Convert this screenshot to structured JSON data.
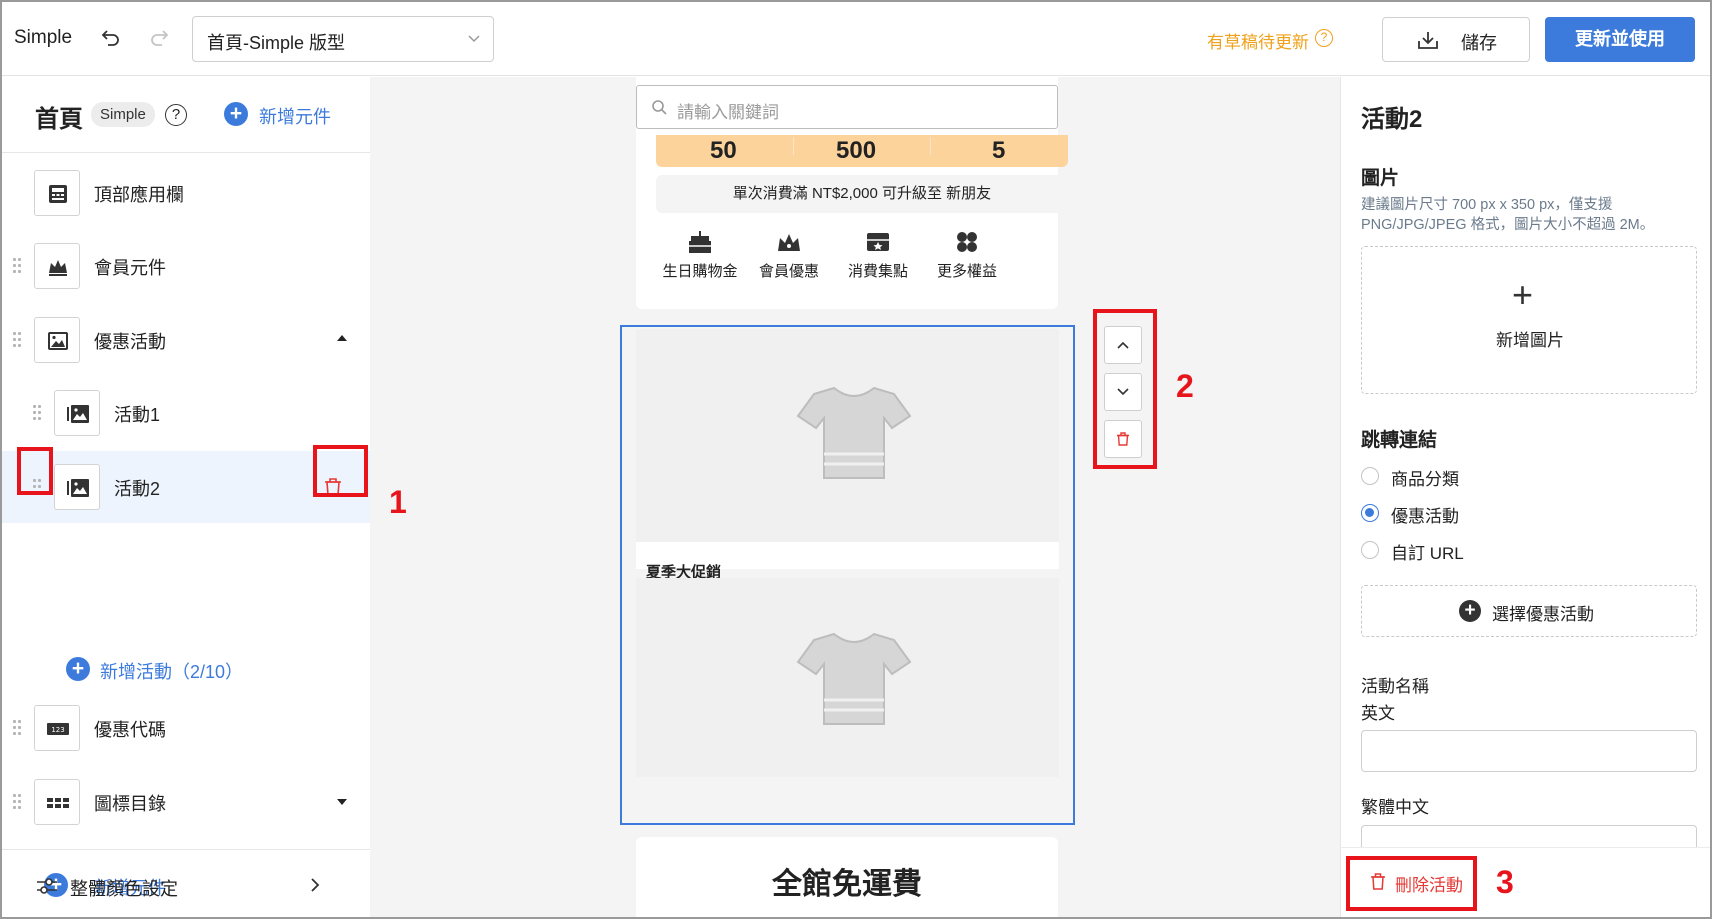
{
  "topbar": {
    "app_name": "Simple",
    "page_select_value": "首頁-Simple 版型",
    "draft_notice": "有草稿待更新",
    "draft_help": "?",
    "save_label": "儲存",
    "publish_label": "更新並使用"
  },
  "left": {
    "title": "首頁",
    "badge": "Simple",
    "help": "?",
    "add_component": "新增元件",
    "items": [
      {
        "label": "頂部應用欄"
      },
      {
        "label": "會員元件"
      },
      {
        "label": "優惠活動"
      },
      {
        "label": "活動1"
      },
      {
        "label": "活動2"
      },
      {
        "label": "優惠代碼"
      },
      {
        "label": "圖標目錄"
      }
    ],
    "add_activity": "新增活動（2/10）",
    "add_component_bottom": "新增元件",
    "color_settings": "整體顏色設定",
    "code_icon_text": "123"
  },
  "preview": {
    "search_placeholder": "請輸入關鍵詞",
    "stats": [
      "50",
      "500",
      "5"
    ],
    "upgrade_text": "單次消費滿 NT$2,000 可升級至 新朋友",
    "benefits": [
      "生日購物金",
      "會員優惠",
      "消費集點",
      "更多權益"
    ],
    "activity_title": "夏季大促銷",
    "free_shipping": "全館免運費"
  },
  "right": {
    "title": "活動2",
    "image_heading": "圖片",
    "image_hint": "建議圖片尺寸 700 px x 350 px，僅支援 PNG/JPG/JPEG 格式，圖片大小不超過 2M。",
    "add_image": "新增圖片",
    "plus": "+",
    "link_heading": "跳轉連結",
    "link_options": [
      "商品分類",
      "優惠活動",
      "自訂 URL"
    ],
    "link_selected": "優惠活動",
    "choose_activity": "選擇優惠活動",
    "choose_plus": "+",
    "name_label": "活動名稱",
    "english_label": "英文",
    "chinese_label": "繁體中文",
    "delete_activity": "刪除活動"
  },
  "annotations": [
    "1",
    "2",
    "3"
  ],
  "colors": {
    "accent": "#3c7bdc",
    "draft": "#f0a11b",
    "danger": "#e53935",
    "annotation": "#e8141b",
    "membership_bar": "#fbd39b"
  }
}
